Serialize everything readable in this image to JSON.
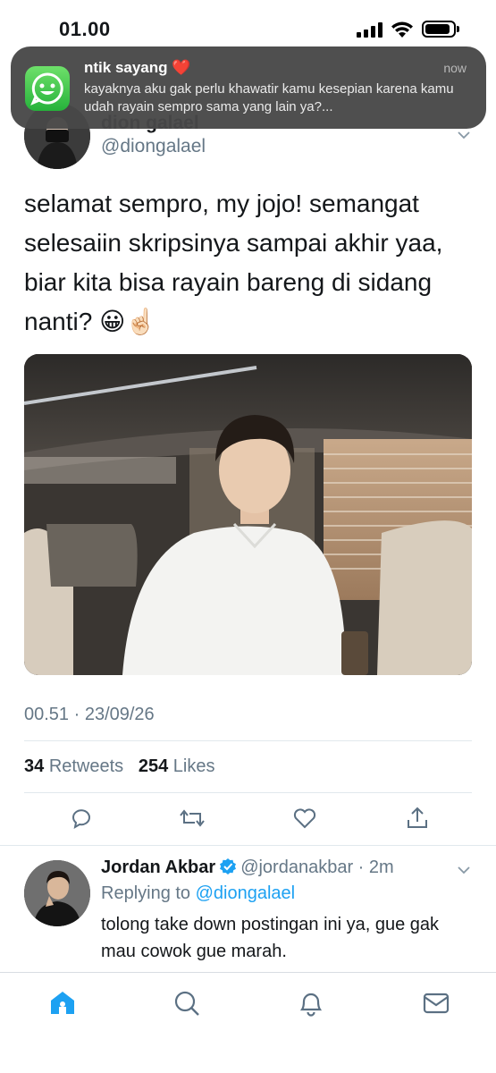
{
  "status_bar": {
    "time": "01.00"
  },
  "notification": {
    "title": "ntik sayang",
    "title_emoji": "❤️",
    "time": "now",
    "body": "kayaknya aku gak perlu khawatir kamu kesepian karena kamu udah rayain sempro sama yang lain ya?..."
  },
  "tweet": {
    "author_name": "dion galael",
    "author_handle": "@diongalael",
    "text": "selamat sempro, my jojo! semangat selesaiin skripsinya sampai akhir yaa, biar kita bisa rayain bareng di sidang nanti? 😀☝🏻",
    "timestamp": "00.51 · 23/09/26",
    "retweets_count": "34",
    "retweets_label": "Retweets",
    "likes_count": "254",
    "likes_label": "Likes"
  },
  "reply": {
    "name": "Jordan Akbar",
    "handle_time": "@jordanakbar · 2m",
    "replying_label": "Replying to",
    "replying_to": "@diongalael",
    "text": "tolong take down postingan ini ya, gue gak mau cowok gue marah."
  },
  "tabs": [
    "home-icon",
    "search-icon",
    "notifications-icon",
    "messages-icon"
  ],
  "colors": {
    "accent": "#1da1f2",
    "secondary_text": "#657786",
    "icon": "#5b7083"
  }
}
